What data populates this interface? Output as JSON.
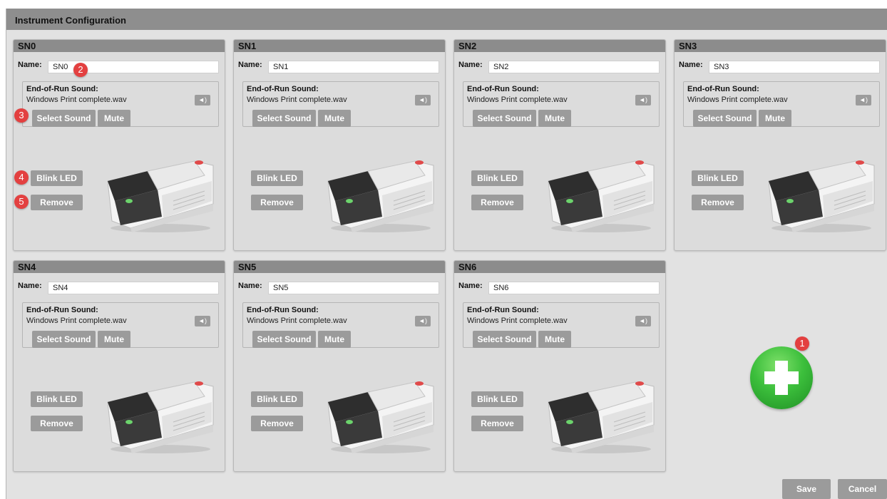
{
  "window": {
    "title": "Instrument Configuration"
  },
  "labels": {
    "name": "Name:",
    "end_of_run": "End-of-Run Sound:",
    "select_sound": "Select Sound",
    "mute": "Mute",
    "blink_led": "Blink LED",
    "remove": "Remove"
  },
  "instruments": [
    {
      "header": "SN0",
      "name": "SN0",
      "sound_file": "Windows Print complete.wav"
    },
    {
      "header": "SN1",
      "name": "SN1",
      "sound_file": "Windows Print complete.wav"
    },
    {
      "header": "SN2",
      "name": "SN2",
      "sound_file": "Windows Print complete.wav"
    },
    {
      "header": "SN3",
      "name": "SN3",
      "sound_file": "Windows Print complete.wav"
    },
    {
      "header": "SN4",
      "name": "SN4",
      "sound_file": "Windows Print complete.wav"
    },
    {
      "header": "SN5",
      "name": "SN5",
      "sound_file": "Windows Print complete.wav"
    },
    {
      "header": "SN6",
      "name": "SN6",
      "sound_file": "Windows Print complete.wav"
    }
  ],
  "badges": [
    "1",
    "2",
    "3",
    "4",
    "5"
  ],
  "footer": {
    "save": "Save",
    "cancel": "Cancel"
  },
  "icons": {
    "speaker": "speaker-icon",
    "add": "plus-icon"
  },
  "colors": {
    "add_button": "#3cbf3c",
    "badge": "#e34040",
    "button": "#9b9b9b"
  }
}
